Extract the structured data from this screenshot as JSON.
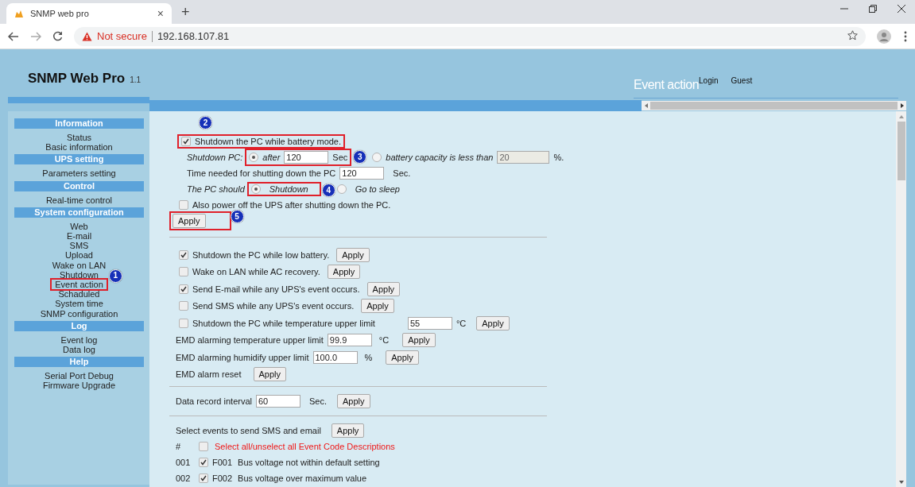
{
  "browser": {
    "tab_title": "SNMP web pro",
    "tab_close": "×",
    "new_tab": "+",
    "security": "Not secure",
    "url": "192.168.107.81"
  },
  "header": {
    "title": "SNMP Web Pro",
    "version": "1.1",
    "page_title": "Event action",
    "login": "Login",
    "user": "Guest"
  },
  "sidebar": [
    {
      "title": "Information",
      "items": [
        {
          "label": "Status",
          "highlighted": false
        },
        {
          "label": "Basic information",
          "highlighted": false
        }
      ]
    },
    {
      "title": "UPS setting",
      "items": [
        {
          "label": "Parameters setting",
          "highlighted": false
        }
      ]
    },
    {
      "title": "Control",
      "items": [
        {
          "label": "Real-time control",
          "highlighted": false
        }
      ]
    },
    {
      "title": "System configuration",
      "items": [
        {
          "label": "Web",
          "highlighted": false
        },
        {
          "label": "E-mail",
          "highlighted": false
        },
        {
          "label": "SMS",
          "highlighted": false
        },
        {
          "label": "Upload",
          "highlighted": false
        },
        {
          "label": "Wake on LAN",
          "highlighted": false
        },
        {
          "label": "Shutdown",
          "highlighted": false
        },
        {
          "label": "Event action",
          "highlighted": true,
          "callout": "1"
        },
        {
          "label": "Schaduled",
          "highlighted": false
        },
        {
          "label": "System time",
          "highlighted": false
        },
        {
          "label": "SNMP configuration",
          "highlighted": false
        }
      ]
    },
    {
      "title": "Log",
      "items": [
        {
          "label": "Event log",
          "highlighted": false
        },
        {
          "label": "Data log",
          "highlighted": false
        }
      ]
    },
    {
      "title": "Help",
      "items": [
        {
          "label": "Serial Port Debug",
          "highlighted": false
        },
        {
          "label": "Firmware Upgrade",
          "highlighted": false
        }
      ]
    }
  ],
  "battery_mode": {
    "checkbox": {
      "label": "Shutdown the PC while battery mode.",
      "checked": true,
      "highlighted": true,
      "callout": "2"
    },
    "shutdown_pc": {
      "label": "Shutdown PC:",
      "options": [
        {
          "label": "after",
          "selected": true,
          "value": "120",
          "unit": "Sec",
          "disabled": false,
          "highlighted": true,
          "callout": "3"
        },
        {
          "label": "battery capacity is less than",
          "selected": false,
          "value": "20",
          "unit": "%.",
          "disabled": true,
          "highlighted": false
        }
      ]
    },
    "time_needed": {
      "label": "Time needed for shutting down the PC",
      "value": "120",
      "unit": "Sec."
    },
    "pc_should": {
      "label": "The PC should",
      "options": [
        {
          "label": "Shutdown",
          "selected": true,
          "highlighted": true,
          "callout": "4"
        },
        {
          "label": "Go to sleep",
          "selected": false,
          "highlighted": false
        }
      ]
    },
    "power_off": {
      "label": "Also power off the UPS after shutting down the PC.",
      "checked": false
    },
    "apply": {
      "label": "Apply",
      "highlighted": true,
      "callout": "5"
    }
  },
  "options": [
    {
      "kind": "check",
      "label": "Shutdown the PC while low battery.",
      "checked": true,
      "apply": "Apply"
    },
    {
      "kind": "check",
      "label": "Wake on LAN while AC recovery.",
      "checked": false,
      "apply": "Apply"
    },
    {
      "kind": "check",
      "label": "Send E-mail while any UPS's event occurs.",
      "checked": true,
      "apply": "Apply"
    },
    {
      "kind": "check",
      "label": "Send SMS while any UPS's event occurs.",
      "checked": false,
      "apply": "Apply"
    },
    {
      "kind": "check_field",
      "label": "Shutdown the PC while temperature upper limit",
      "checked": false,
      "value": "55",
      "unit": "°C",
      "apply": "Apply"
    },
    {
      "kind": "field",
      "label": "EMD alarming temperature upper limit",
      "value": "99.9",
      "unit": "°C",
      "apply": "Apply"
    },
    {
      "kind": "field",
      "label": "EMD alarming humidify upper limit",
      "value": "100.0",
      "unit": "%",
      "apply": "Apply"
    },
    {
      "kind": "button",
      "label": "EMD alarm reset",
      "apply": "Apply"
    }
  ],
  "data_record": {
    "label": "Data record interval",
    "value": "60",
    "unit": "Sec.",
    "apply": "Apply"
  },
  "events": {
    "label": "Select events to send SMS and email",
    "apply": "Apply",
    "hash": "#",
    "select_all": {
      "label": "Select all/unselect all Event Code Descriptions",
      "checked": false
    },
    "rows": [
      {
        "number": "001",
        "checked": true,
        "code": "F001",
        "description": "Bus voltage not within default setting"
      },
      {
        "number": "002",
        "checked": true,
        "code": "F002",
        "description": "Bus voltage over maximum value"
      }
    ]
  }
}
